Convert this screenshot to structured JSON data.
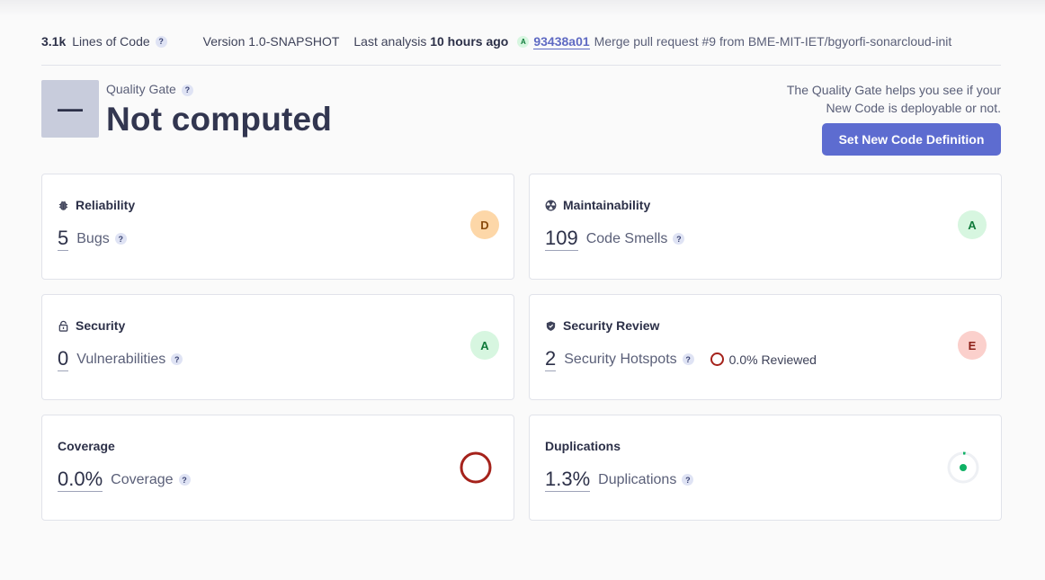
{
  "meta": {
    "loc_value": "3.1k",
    "loc_label": "Lines of Code",
    "version": "Version 1.0-SNAPSHOT",
    "last_analysis_prefix": "Last analysis",
    "last_analysis_time": "10 hours ago",
    "mini_gate": "A",
    "commit_hash": "93438a01",
    "commit_message": "Merge pull request #9 from BME-MIT-IET/bgyorfi-sonarcloud-init"
  },
  "quality_gate": {
    "icon_text": "—",
    "label": "Quality Gate",
    "status": "Not computed",
    "info_line1": "The Quality Gate helps you see if your",
    "info_line2": "New Code is deployable or not.",
    "button_label": "Set New Code Definition"
  },
  "help_glyph": "?",
  "cards": {
    "reliability": {
      "title": "Reliability",
      "value": "5",
      "label": "Bugs",
      "rating": "D",
      "icon": "bug-icon"
    },
    "maintainability": {
      "title": "Maintainability",
      "value": "109",
      "label": "Code Smells",
      "rating": "A",
      "icon": "radiation-icon"
    },
    "security": {
      "title": "Security",
      "value": "0",
      "label": "Vulnerabilities",
      "rating": "A",
      "icon": "lock-icon"
    },
    "security_review": {
      "title": "Security Review",
      "value": "2",
      "label": "Security Hotspots",
      "reviewed": "0.0% Reviewed",
      "rating": "E",
      "icon": "shield-icon"
    },
    "coverage": {
      "title": "Coverage",
      "value": "0.0%",
      "label": "Coverage",
      "percent": 0.0
    },
    "duplications": {
      "title": "Duplications",
      "value": "1.3%",
      "label": "Duplications",
      "percent": 1.3
    }
  },
  "colors": {
    "rating_A_bg": "#d7f6e0",
    "rating_A_fg": "#0f7a3a",
    "rating_D_bg": "#fdd7a8",
    "rating_D_fg": "#8a4b0d",
    "rating_E_bg": "#fbd0cc",
    "rating_E_fg": "#8c1f17",
    "accent": "#5d6cd0",
    "coverage_ring": "#a5221b",
    "duplication_dot": "#0fb164"
  }
}
